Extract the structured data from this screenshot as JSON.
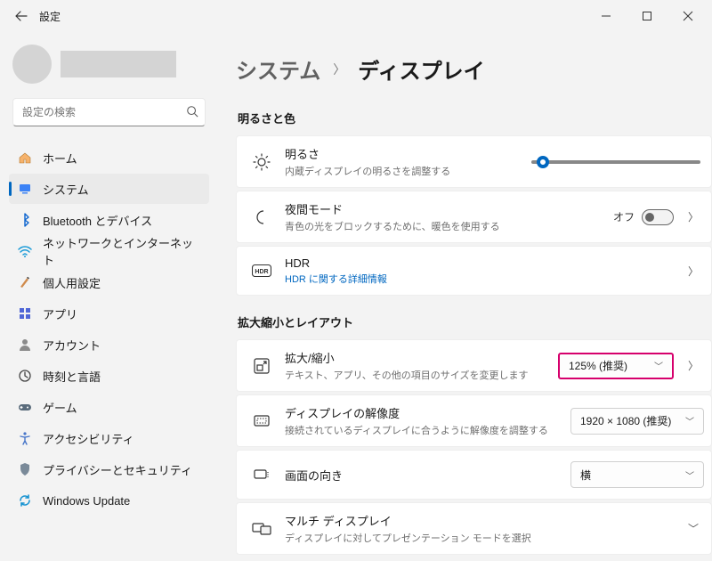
{
  "window": {
    "title": "設定"
  },
  "search": {
    "placeholder": "設定の検索"
  },
  "nav": {
    "items": [
      {
        "key": "home",
        "label": "ホーム"
      },
      {
        "key": "system",
        "label": "システム"
      },
      {
        "key": "bt",
        "label": "Bluetooth とデバイス"
      },
      {
        "key": "net",
        "label": "ネットワークとインターネット"
      },
      {
        "key": "perso",
        "label": "個人用設定"
      },
      {
        "key": "apps",
        "label": "アプリ"
      },
      {
        "key": "account",
        "label": "アカウント"
      },
      {
        "key": "time",
        "label": "時刻と言語"
      },
      {
        "key": "game",
        "label": "ゲーム"
      },
      {
        "key": "access",
        "label": "アクセシビリティ"
      },
      {
        "key": "privacy",
        "label": "プライバシーとセキュリティ"
      },
      {
        "key": "update",
        "label": "Windows Update"
      }
    ]
  },
  "breadcrumb": {
    "parent": "システム",
    "current": "ディスプレイ"
  },
  "sections": {
    "brightness": {
      "title": "明るさと色",
      "brightness": {
        "primary": "明るさ",
        "secondary": "内蔵ディスプレイの明るさを調整する"
      },
      "night": {
        "primary": "夜間モード",
        "secondary": "青色の光をブロックするために、暖色を使用する",
        "state": "オフ"
      },
      "hdr": {
        "primary": "HDR",
        "link": "HDR に関する詳細情報"
      }
    },
    "scale": {
      "title": "拡大縮小とレイアウト",
      "scale": {
        "primary": "拡大/縮小",
        "secondary": "テキスト、アプリ、その他の項目のサイズを変更します",
        "value": "125% (推奨)"
      },
      "res": {
        "primary": "ディスプレイの解像度",
        "secondary": "接続されているディスプレイに合うように解像度を調整する",
        "value": "1920 × 1080 (推奨)"
      },
      "orient": {
        "primary": "画面の向き",
        "value": "横"
      },
      "multi": {
        "primary": "マルチ ディスプレイ",
        "secondary": "ディスプレイに対してプレゼンテーション モードを選択"
      }
    }
  }
}
